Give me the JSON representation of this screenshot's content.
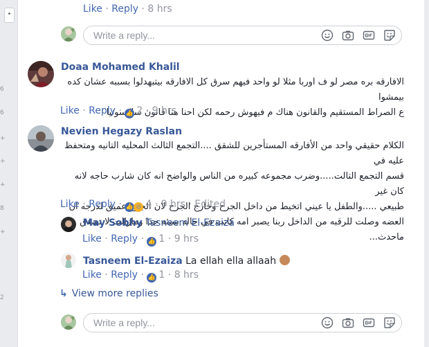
{
  "sep": "·",
  "top_actions": {
    "like": "Like",
    "reply": "Reply",
    "time": "8 hrs"
  },
  "reply_box": {
    "placeholder": "Write a reply..."
  },
  "comments": [
    {
      "name": "Doaa Mohamed Khalil",
      "text_line1": "الافارقه بره مصر لو ف اوربا مثلا لو واحد فيهم سرق كل الافارقه بيتبهدلوا بسببه عشان كده بيمشوا",
      "text_line2": "ع الصراط المستقيم والقانون هناك م فيهوش رحمه لكن احنا هنا قانون ساكسونيا",
      "like": "Like",
      "reply": "Reply",
      "reactions": "2",
      "time": "9 hrs"
    },
    {
      "name": "Nevien Hegazy Raslan",
      "text_line1": "الكلام حقيقي واحد من الأفارقه المستأجرين للشقق ....التجمع الثالث المحليه التانيه ومتحفظ عليه في",
      "text_line2": "قسم التجمع التالت.....وضرب مجموعه كبيره من الناس والواضح انه كان شارب حاجه لانه كان غير",
      "text_line3": "طبيعي .....والطفل يا عيني اتخيط من داخل الجرح وخارج الجرح لان الجرح عميق لدرجه ان",
      "text_line4": "العضه وصلت للرقبه من الداخل ربنا يصبر امه كانت في حاله سيئه جدا ومازالت لا تصدق ماحدث...",
      "like": "Like",
      "reply": "Reply",
      "reactions": "4",
      "time": "9 hrs",
      "edited": "Edited"
    }
  ],
  "replies": [
    {
      "name": "May Sobhy",
      "text": "Tasneem El-Ezaiza",
      "like": "Like",
      "reply": "Reply",
      "reactions": "1",
      "time": "9 hrs"
    },
    {
      "name": "Tasneem El-Ezaiza",
      "text": "La ellah ella allaah",
      "like": "Like",
      "reply": "Reply",
      "reactions": "1",
      "time": "8 hrs"
    }
  ],
  "view_more": "View more replies",
  "colors": {
    "link": "#385898",
    "action": "#4267b2",
    "meta": "#90949c"
  }
}
